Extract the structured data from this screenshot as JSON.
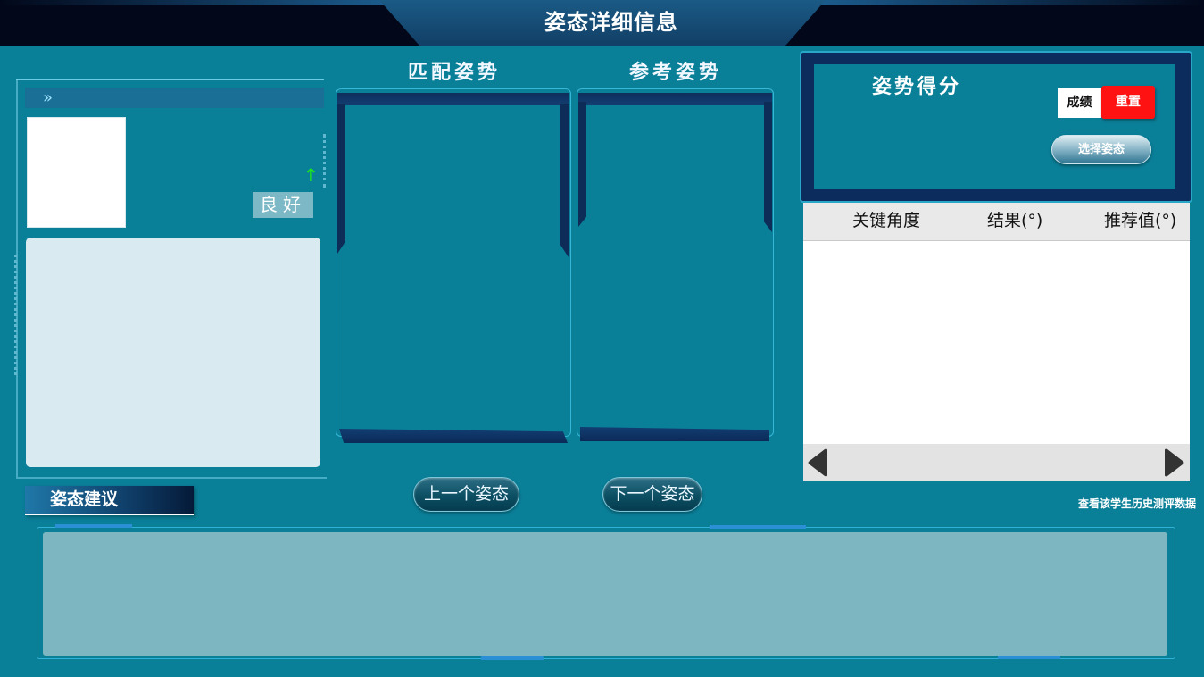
{
  "header": {
    "title": "姿态详细信息"
  },
  "left_panel": {
    "rating": "良好",
    "icons": {
      "expand": "double-chevron-right-icon",
      "trend": "up-arrow-icon"
    }
  },
  "advice": {
    "label": "姿态建议",
    "text": ""
  },
  "poses": {
    "match_title": "匹配姿势",
    "reference_title": "参考姿势",
    "prev_label": "上一个姿态",
    "next_label": "下一个姿态"
  },
  "score": {
    "title": "姿势得分",
    "grade_label": "成绩",
    "reset_label": "重置",
    "select_label": "选择姿态"
  },
  "table": {
    "columns": [
      "关键角度",
      "结果(°)",
      "推荐值(°)"
    ],
    "rows": []
  },
  "history": {
    "link_label": "查看该学生历史测评数据"
  },
  "colors": {
    "background": "#0a7f98",
    "header": "#02081a",
    "reset": "#ff1212",
    "trend_up": "#1ee61e"
  }
}
